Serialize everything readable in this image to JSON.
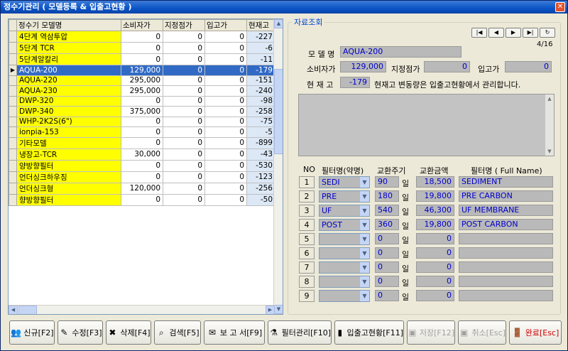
{
  "window": {
    "title": "정수기관리 ( 모델등록 & 입출고현황 )",
    "close": "✕"
  },
  "grid": {
    "columns": [
      "정수기 모델명",
      "소비자가",
      "지정점가",
      "입고가",
      "현재고"
    ],
    "rows": [
      {
        "name": "4단계 역삼투압",
        "price": "0",
        "store": "0",
        "in": "0",
        "stock": "-227"
      },
      {
        "name": "5단계 TCR",
        "price": "0",
        "store": "0",
        "in": "0",
        "stock": "-6"
      },
      {
        "name": "5단계알칼리",
        "price": "0",
        "store": "0",
        "in": "0",
        "stock": "-11"
      },
      {
        "name": "AQUA-200",
        "price": "129,000",
        "store": "0",
        "in": "0",
        "stock": "-179"
      },
      {
        "name": "AQUA-220",
        "price": "295,000",
        "store": "0",
        "in": "0",
        "stock": "-151"
      },
      {
        "name": "AQUA-230",
        "price": "295,000",
        "store": "0",
        "in": "0",
        "stock": "-240"
      },
      {
        "name": "DWP-320",
        "price": "0",
        "store": "0",
        "in": "0",
        "stock": "-98"
      },
      {
        "name": "DWP-340",
        "price": "375,000",
        "store": "0",
        "in": "0",
        "stock": "-258"
      },
      {
        "name": "WHP-2K2S(6\")",
        "price": "0",
        "store": "0",
        "in": "0",
        "stock": "-75"
      },
      {
        "name": "ionpia-153",
        "price": "0",
        "store": "0",
        "in": "0",
        "stock": "-5"
      },
      {
        "name": "기타모델",
        "price": "0",
        "store": "0",
        "in": "0",
        "stock": "-899"
      },
      {
        "name": "냉장고-TCR",
        "price": "30,000",
        "store": "0",
        "in": "0",
        "stock": "-43"
      },
      {
        "name": "양방향필터",
        "price": "0",
        "store": "0",
        "in": "0",
        "stock": "-530"
      },
      {
        "name": "언더싱크하우징",
        "price": "0",
        "store": "0",
        "in": "0",
        "stock": "-123"
      },
      {
        "name": "언더싱크형",
        "price": "120,000",
        "store": "0",
        "in": "0",
        "stock": "-256"
      },
      {
        "name": "향방향필터",
        "price": "0",
        "store": "0",
        "in": "0",
        "stock": "-50"
      }
    ],
    "selected_index": 3
  },
  "detail": {
    "group_label": "자료조회",
    "pager": "4/16",
    "model_label": "모 델 명",
    "model_value": "AQUA-200",
    "price_label": "소비자가",
    "price_value": "129,000",
    "store_label": "지정점가",
    "store_value": "0",
    "in_label": "입고가",
    "in_value": "0",
    "stock_label": "현 재 고",
    "stock_value": "-179",
    "stock_note": "현재고 변동량은 입출고현황에서 관리합니다.",
    "filter_headers": {
      "no": "NO",
      "name": "필터명(약명)",
      "cycle": "교환주기",
      "amount": "교환금액",
      "full": "필터명 ( Full Name)"
    },
    "day_unit": "일",
    "filters": [
      {
        "no": "1",
        "name": "SEDI",
        "cycle": "90",
        "amount": "18,500",
        "full": "SEDIMENT"
      },
      {
        "no": "2",
        "name": "PRE",
        "cycle": "180",
        "amount": "19,800",
        "full": "PRE CARBON"
      },
      {
        "no": "3",
        "name": "UF",
        "cycle": "540",
        "amount": "46,300",
        "full": "UF MEMBRANE"
      },
      {
        "no": "4",
        "name": "POST",
        "cycle": "360",
        "amount": "19,800",
        "full": "POST CARBON"
      },
      {
        "no": "5",
        "name": "",
        "cycle": "0",
        "amount": "0",
        "full": ""
      },
      {
        "no": "6",
        "name": "",
        "cycle": "0",
        "amount": "0",
        "full": ""
      },
      {
        "no": "7",
        "name": "",
        "cycle": "0",
        "amount": "0",
        "full": ""
      },
      {
        "no": "8",
        "name": "",
        "cycle": "0",
        "amount": "0",
        "full": ""
      },
      {
        "no": "9",
        "name": "",
        "cycle": "0",
        "amount": "0",
        "full": ""
      }
    ]
  },
  "buttons": {
    "new": "신규[F2]",
    "edit": "수정[F3]",
    "delete": "삭제[F4]",
    "search": "검색[F5]",
    "report": "보 고 서[F9]",
    "filter": "필터관리[F10]",
    "inout": "입출고현황[F11]",
    "save": "저장[F12]",
    "cancel": "취소[Esc]",
    "done": "완료[Esc]"
  },
  "colors": {
    "title_bar": "#0a54c6",
    "selection": "#316ac5",
    "model_highlight": "#ffff00",
    "value_text": "#0000cc"
  }
}
